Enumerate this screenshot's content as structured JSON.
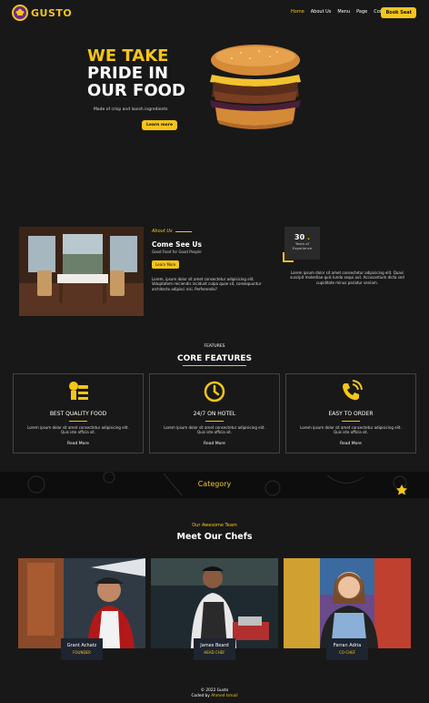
{
  "brand": {
    "name": "GUSTO"
  },
  "nav": {
    "items": [
      {
        "label": "Home",
        "active": true
      },
      {
        "label": "About Us"
      },
      {
        "label": "Menu"
      },
      {
        "label": "Page"
      },
      {
        "label": "Contact"
      }
    ],
    "cta": "Book Seat"
  },
  "hero": {
    "line1": "WE TAKE",
    "line2": "PRIDE IN",
    "line3": "OUR FOOD",
    "subtitle": "Made of crisp and lavish ingredients",
    "button": "Learn more"
  },
  "about": {
    "eyebrow": "About Us",
    "title": "Come See Us",
    "subtitle": "Good Food for Good People",
    "button": "Learn More",
    "body": "Lorem, ipsum dolor sit amet consectetur adipisicing elit. Voluptatem reiciendis incidunt culpa quae sit, consequuntur architecto adipisci nisi. Perferendis?",
    "experience": {
      "number": "30",
      "dot": ".",
      "label1": "Years of",
      "label2": "Experience"
    },
    "side_body": "Lorem ipsum dolor sit amet consectetur adipisicing elit. Quasi suscipit molestiae quis lundo sequi aut. Accusantium dicta sed cupiditate minus pariatur veniam."
  },
  "features": {
    "eyebrow": "FEATURES",
    "title": "CORE FEATURES",
    "cards": [
      {
        "icon": "chef-service-icon",
        "title": "BEST QUALITY FOOD",
        "desc": "Lorem ipsum dolor sit amet consectetur adipisicing elit. Quis iste officia sit.",
        "link": "Read More"
      },
      {
        "icon": "clock-icon",
        "title": "24/7 ON HOTEL",
        "desc": "Lorem ipsum dolor sit amet consectetur adipisicing elit. Quis iste officia sit.",
        "link": "Read More"
      },
      {
        "icon": "phone-icon",
        "title": "EASY TO ORDER",
        "desc": "Lorem ipsum dolor sit amet consectetur adipisicing elit. Quis iste officia sit.",
        "link": "Read More"
      }
    ]
  },
  "category": {
    "label": "Category"
  },
  "chefs": {
    "eyebrow": "Our Awesome Team",
    "title": "Meet Our Chefs",
    "members": [
      {
        "name": "Grant Achatz",
        "role": "FOUNDER"
      },
      {
        "name": "James Beard",
        "role": "HEAD CHEF"
      },
      {
        "name": "Ferran Adria",
        "role": "CO-CHEF"
      }
    ]
  },
  "footer": {
    "copyright": "© 2022 Gusto",
    "coded_by": "Coded by",
    "author": "Ahmed Ismail"
  },
  "colors": {
    "accent": "#f5c518",
    "background": "#181818",
    "card_border": "#444444"
  }
}
